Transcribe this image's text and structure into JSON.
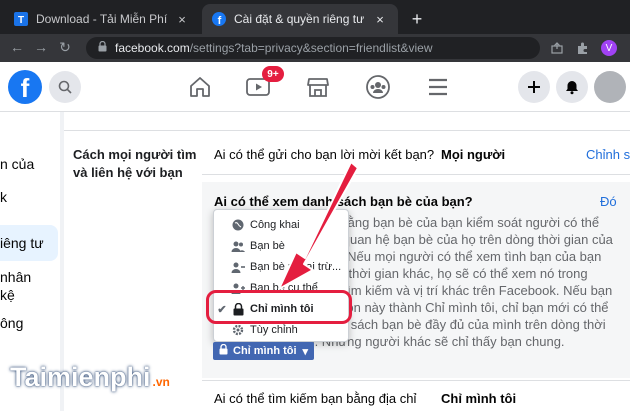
{
  "browser": {
    "tabs": [
      {
        "title": "Download - Tải Miễn Phí VN - Ph",
        "close": "×",
        "active": false
      },
      {
        "title": "Cài đặt & quyền riêng tư | Faceb",
        "close": "×",
        "active": true
      }
    ],
    "new_tab": "+",
    "url_host": "facebook.com",
    "url_path": "/settings?tab=privacy&section=friendlist&view",
    "profile_initial": "V"
  },
  "facebook_header": {
    "logo": "f",
    "notification_badge": "9+"
  },
  "sidebar": {
    "items": [
      "n của",
      "k",
      "iêng tư",
      "nhân",
      "kệ",
      "ông"
    ]
  },
  "settings": {
    "section_label": "Cách mọi người tìm và liên hệ với bạn",
    "row1": {
      "question": "Ai có thể gửi cho bạn lời mời kết bạn?",
      "value": "Mọi người",
      "action": "Chỉnh s"
    },
    "row2": {
      "question": "Ai có thể xem danh sách bạn bè của bạn?",
      "close": "Đó"
    },
    "description": "Hãy nhớ rằng bạn bè của bạn kiểm soát người có thể xem mối quan hệ bạn bè của họ trên dòng thời gian của chính họ. Nếu mọi người có thể xem tình bạn của bạn trên dòng thời gian khác, họ sẽ có thể xem nó trong bảng tin, tìm kiếm và vị trí khác trên Facebook. Nếu bạn đặt tùy chọn này thành Chỉ mình tôi, chỉ bạn mới có thể xem danh sách bạn bè đầy đủ của mình trên dòng thời gian. Những người khác sẽ chỉ thấy bạn chung.",
    "row3": {
      "question": "Ai có thể tìm kiếm bạn bằng địa chỉ",
      "value": "Chỉ mình tôi"
    }
  },
  "audience_menu": {
    "items": [
      {
        "label": "Công khai",
        "icon": "globe-icon",
        "selected": false
      },
      {
        "label": "Bạn bè",
        "icon": "friends-icon",
        "selected": false
      },
      {
        "label": "Bạn bè ngoại trừ...",
        "icon": "friends-except-icon",
        "selected": false
      },
      {
        "label": "Bạn bè cụ thể",
        "icon": "specific-friends-icon",
        "selected": false
      },
      {
        "label": "Chỉ mình tôi",
        "icon": "lock-icon",
        "selected": true
      },
      {
        "label": "Tùy chỉnh",
        "icon": "gear-icon",
        "selected": false
      }
    ],
    "checkmark": "✔",
    "button_label": "Chỉ mình tôi",
    "button_caret": "▾"
  },
  "watermark": {
    "text": "Taimienphi",
    "suffix": ".vn"
  },
  "colors": {
    "accent": "#1877f2",
    "highlight": "#e41e3f",
    "link": "#216fdb",
    "dropdown_button": "#4267b2"
  }
}
